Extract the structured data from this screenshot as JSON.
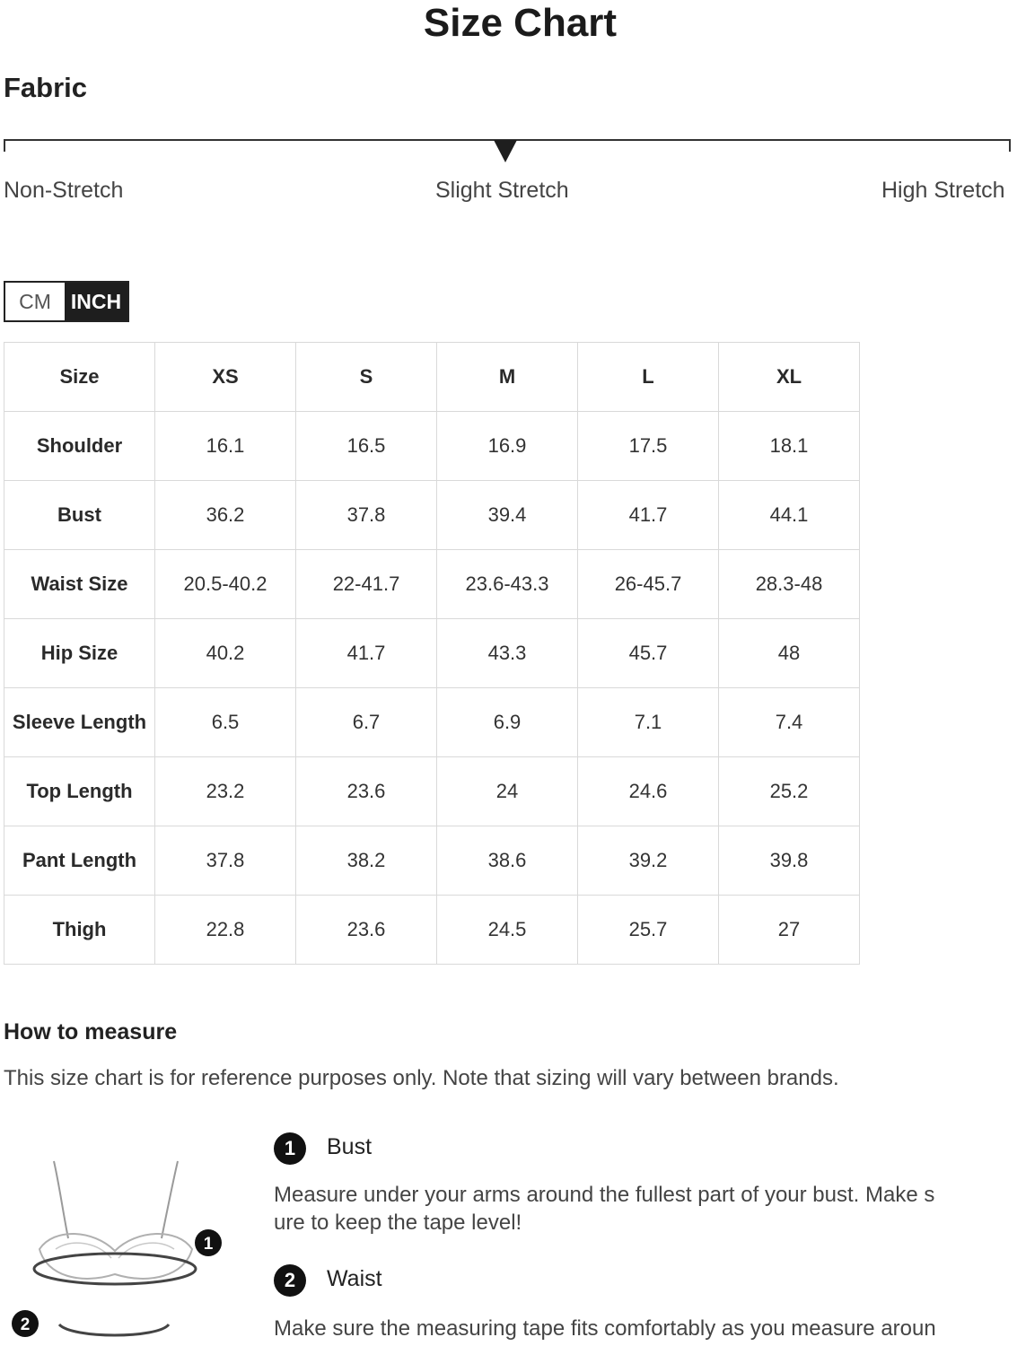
{
  "title": "Size Chart",
  "fabric": {
    "heading": "Fabric",
    "labels": [
      "Non-Stretch",
      "Slight Stretch",
      "High Stretch"
    ],
    "selected": "Slight Stretch"
  },
  "units": {
    "cm": "CM",
    "inch": "INCH",
    "active": "INCH"
  },
  "table": {
    "headers": [
      "Size",
      "XS",
      "S",
      "M",
      "L",
      "XL"
    ],
    "rows": [
      [
        "Shoulder",
        "16.1",
        "16.5",
        "16.9",
        "17.5",
        "18.1"
      ],
      [
        "Bust",
        "36.2",
        "37.8",
        "39.4",
        "41.7",
        "44.1"
      ],
      [
        "Waist Size",
        "20.5-40.2",
        "22-41.7",
        "23.6-43.3",
        "26-45.7",
        "28.3-48"
      ],
      [
        "Hip Size",
        "40.2",
        "41.7",
        "43.3",
        "45.7",
        "48"
      ],
      [
        "Sleeve Length",
        "6.5",
        "6.7",
        "6.9",
        "7.1",
        "7.4"
      ],
      [
        "Top Length",
        "23.2",
        "23.6",
        "24",
        "24.6",
        "25.2"
      ],
      [
        "Pant Length",
        "37.8",
        "38.2",
        "38.6",
        "39.2",
        "39.8"
      ],
      [
        "Thigh",
        "22.8",
        "23.6",
        "24.5",
        "25.7",
        "27"
      ]
    ]
  },
  "how_to_measure": {
    "heading": "How to measure",
    "note": "This size chart is for reference purposes only. Note that sizing will vary between brands.",
    "steps": [
      {
        "number": "1",
        "title": "Bust",
        "description": "Measure under your arms around the fullest part of your bust. Make s ure to keep the tape level!"
      },
      {
        "number": "2",
        "title": "Waist",
        "description": "Make sure the measuring tape fits comfortably as you measure aroun"
      }
    ]
  }
}
